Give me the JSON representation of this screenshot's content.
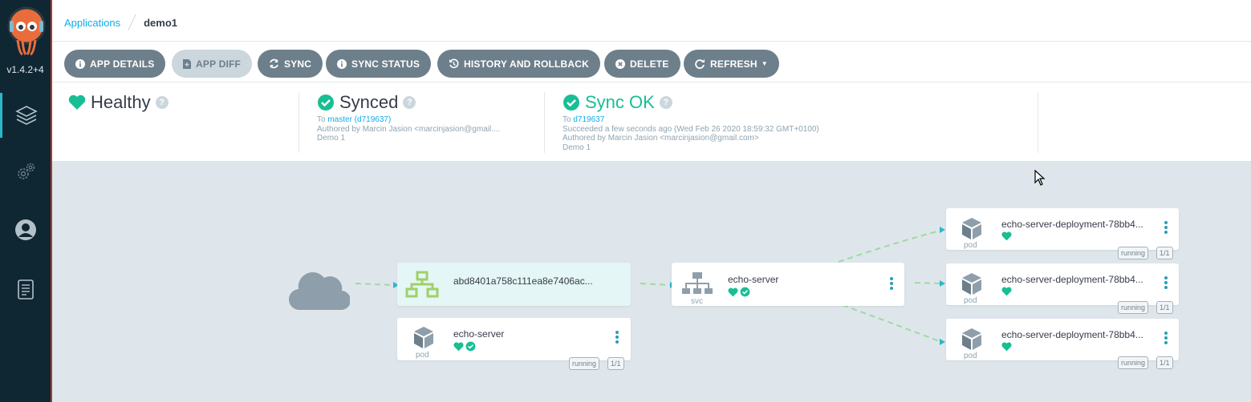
{
  "sidebar": {
    "version": "v1.4.2+4"
  },
  "breadcrumb": {
    "root": "Applications",
    "current": "demo1"
  },
  "toolbar": {
    "app_details": "APP DETAILS",
    "app_diff": "APP DIFF",
    "sync": "SYNC",
    "sync_status": "SYNC STATUS",
    "history": "HISTORY AND ROLLBACK",
    "delete": "DELETE",
    "refresh": "REFRESH"
  },
  "status": {
    "health": {
      "title": "Healthy"
    },
    "sync": {
      "title": "Synced",
      "to_prefix": "To",
      "to_link": "master (d719637)",
      "authored": "Authored by Marcin Jasion <marcinjasion@gmail....",
      "message": "Demo 1"
    },
    "operation": {
      "title": "Sync OK",
      "to_prefix": "To",
      "to_link": "d719637",
      "succeeded": "Succeeded a few seconds ago (Wed Feb 26 2020 18:59:32 GMT+0100)",
      "authored": "Authored by Marcin Jasion <marcinjasion@gmail.com>",
      "message": "Demo 1"
    }
  },
  "graph": {
    "ingress": {
      "name": "abd8401a758c111ea8e7406ac..."
    },
    "svc": {
      "name": "echo-server",
      "kind": "svc"
    },
    "app_pod": {
      "name": "echo-server",
      "kind": "pod",
      "status": "running",
      "count": "1/1"
    },
    "pods": [
      {
        "name": "echo-server-deployment-78bb4...",
        "kind": "pod",
        "status": "running",
        "count": "1/1"
      },
      {
        "name": "echo-server-deployment-78bb4...",
        "kind": "pod",
        "status": "running",
        "count": "1/1"
      },
      {
        "name": "echo-server-deployment-78bb4...",
        "kind": "pod",
        "status": "running",
        "count": "1/1"
      }
    ]
  },
  "colors": {
    "healthy": "#18be94",
    "accent": "#2bb8c6",
    "sidebar": "#0f2733",
    "button": "#6d7f8b"
  }
}
